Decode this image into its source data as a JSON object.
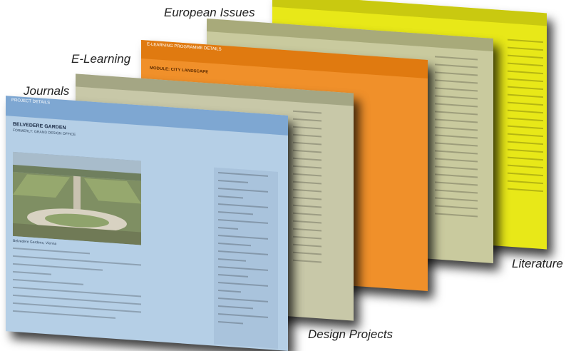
{
  "captions": {
    "european_issues": "European Issues",
    "e_learning": "E-Learning",
    "journals": "Journals",
    "literature": "Literature",
    "design_projects": "Design Projects"
  },
  "colors": {
    "literature": "#e8e818",
    "european": "#c9ca9e",
    "elearning": "#f0902a",
    "elearning_bar": "#e07a10",
    "journals": "#c8c8a8",
    "design": "#b5cfe6",
    "design_bar": "#7ea7d2",
    "link_blue": "#2a4fb0"
  },
  "design_card": {
    "header": "PROJECT DETAILS",
    "title": "BELVEDERE GARDEN",
    "subtitle": "FORMERLY: GRAND DESIGN OFFICE",
    "image_caption": "Belvedere Gardens, Vienna"
  },
  "elearning_card": {
    "header": "E-LEARNING PROGRAMME DETAILS",
    "title": "MODULE: CITY LANDSCAPE"
  }
}
